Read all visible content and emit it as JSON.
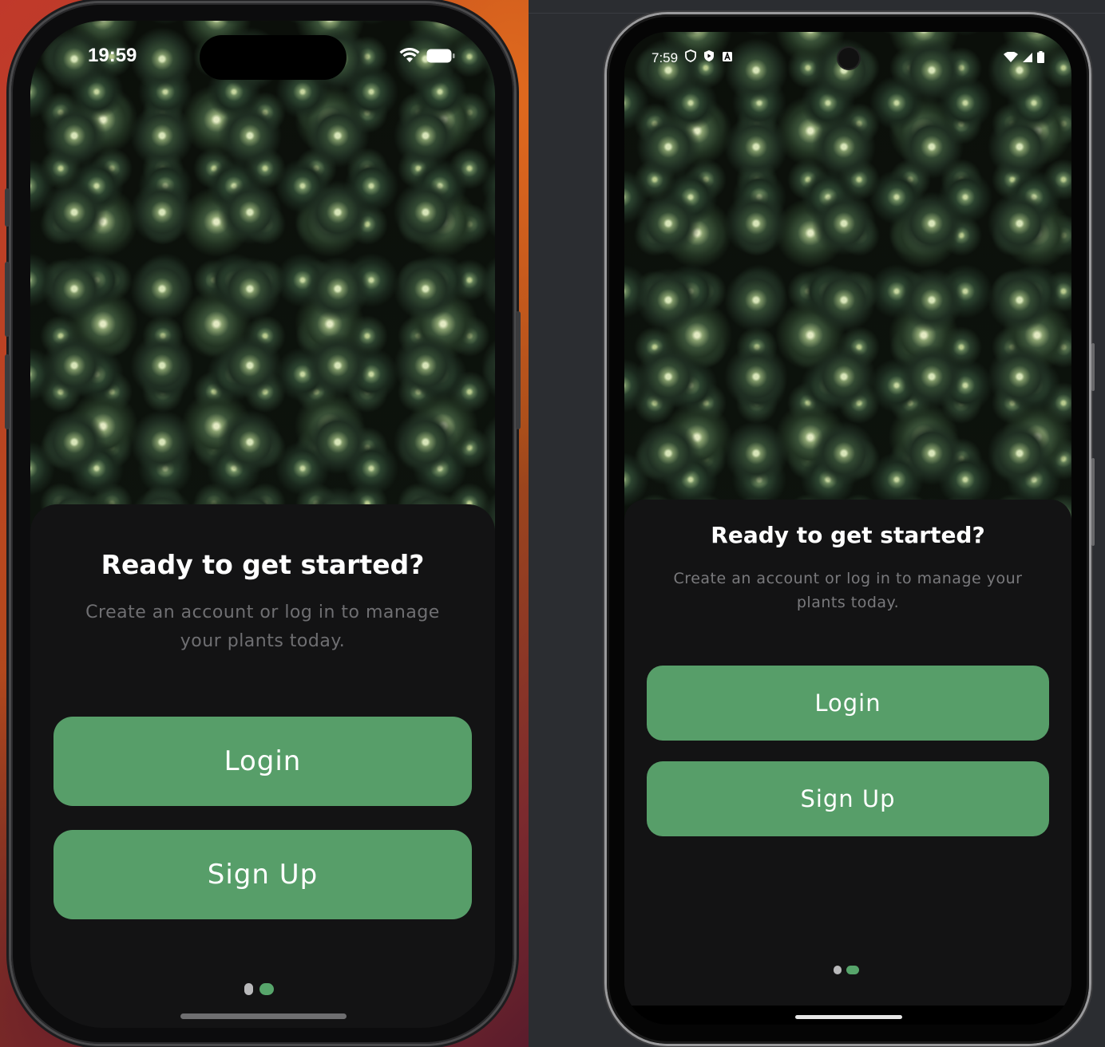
{
  "ios": {
    "status_time": "19:59",
    "welcome": {
      "title": "Ready to get started?",
      "subtitle": "Create an account or log in to manage your plants today.",
      "login_label": "Login",
      "signup_label": "Sign Up"
    },
    "page_indicator": {
      "count": 2,
      "active_index": 1
    }
  },
  "android": {
    "status_time": "7:59",
    "status_icons": [
      "shield-icon",
      "play-protect-icon",
      "keyboard-a-icon"
    ],
    "welcome": {
      "title": "Ready to get started?",
      "subtitle": "Create an account or log in to manage your plants today.",
      "login_label": "Login",
      "signup_label": "Sign Up"
    },
    "page_indicator": {
      "count": 2,
      "active_index": 1
    }
  },
  "theme": {
    "accent": "#579e69",
    "card_background": "#131314",
    "dot_inactive": "#b9b9bb"
  }
}
